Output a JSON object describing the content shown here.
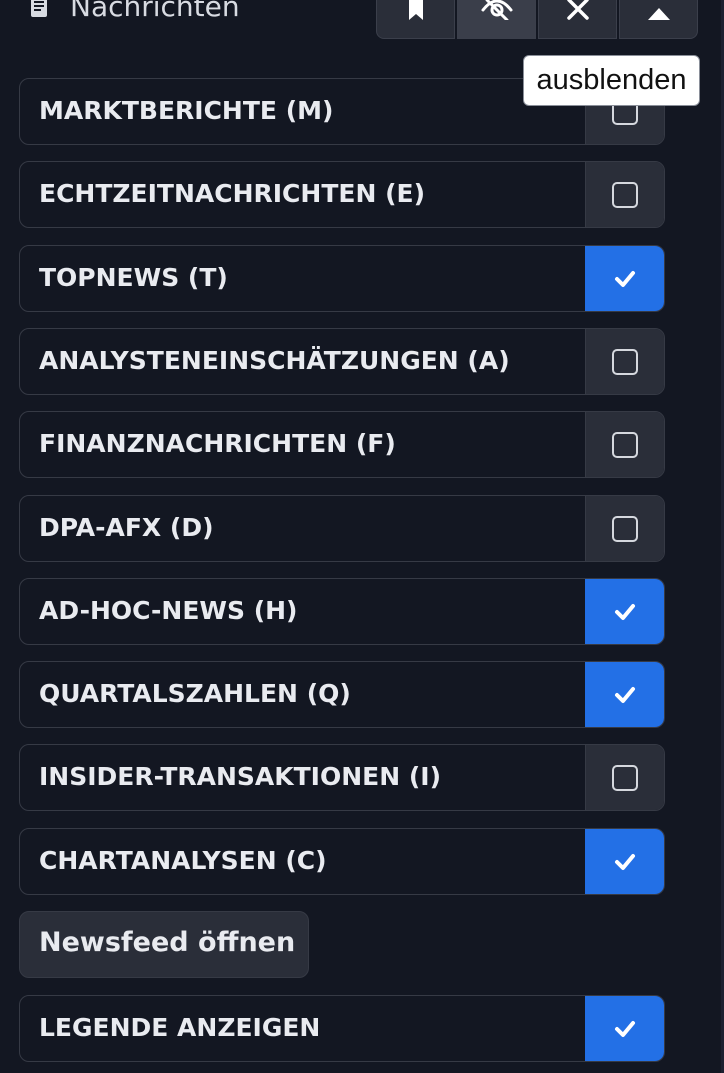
{
  "header": {
    "title": "Nachrichten",
    "icon": "newspaper-icon",
    "tools": [
      {
        "icon": "bookmark-icon"
      },
      {
        "icon": "eye-off-icon",
        "active": true
      },
      {
        "icon": "close-icon"
      },
      {
        "icon": "collapse-up-icon"
      }
    ]
  },
  "tooltip": {
    "text": "ausblenden"
  },
  "categories": [
    {
      "label": "MARKTBERICHTE (M)",
      "checked": false
    },
    {
      "label": "ECHTZEITNACHRICHTEN (E)",
      "checked": false
    },
    {
      "label": "TOPNEWS (T)",
      "checked": true
    },
    {
      "label": "ANALYSTENEINSCHÄTZUNGEN (A)",
      "checked": false
    },
    {
      "label": "FINANZNACHRICHTEN (F)",
      "checked": false
    },
    {
      "label": "DPA-AFX (D)",
      "checked": false
    },
    {
      "label": "AD-HOC-NEWS (H)",
      "checked": true
    },
    {
      "label": "QUARTALSZAHLEN (Q)",
      "checked": true
    },
    {
      "label": "INSIDER-TRANSAKTIONEN (I)",
      "checked": false
    },
    {
      "label": "CHARTANALYSEN (C)",
      "checked": true
    }
  ],
  "newsfeed_button": {
    "label": "Newsfeed öffnen"
  },
  "legend_toggle": {
    "label": "LEGENDE ANZEIGEN",
    "checked": true
  },
  "colors": {
    "background": "#131722",
    "accent": "#2370e6",
    "unchecked_box": "#2a2e39",
    "border": "#363a45",
    "text": "#e9ebf0"
  }
}
